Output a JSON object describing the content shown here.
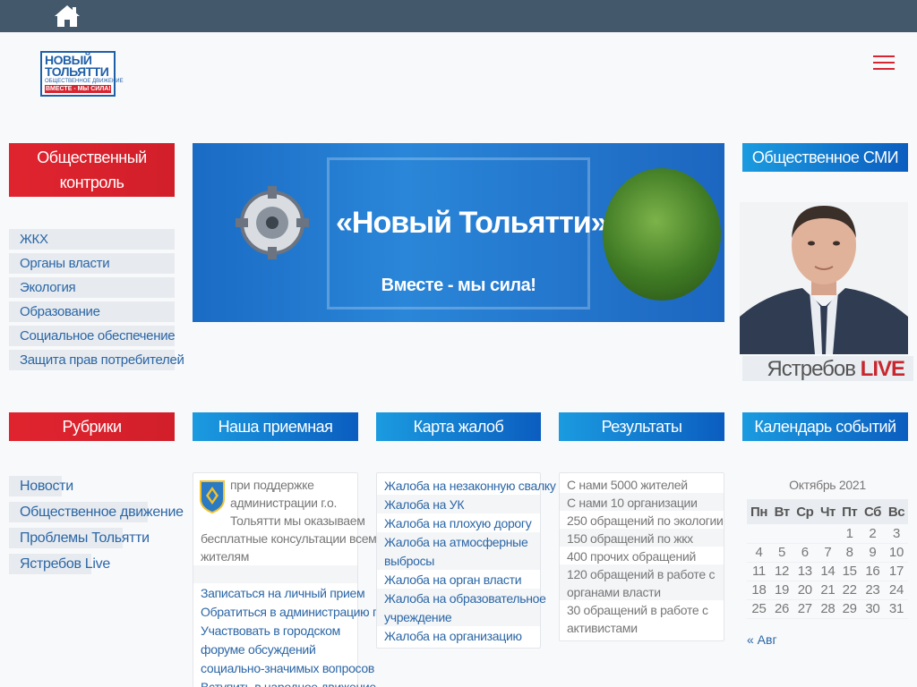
{
  "header": {
    "logo": {
      "line1": "НОВЫЙ",
      "line2": "ТОЛЬЯТТИ",
      "line3": "ОБЩЕСТВЕННОЕ ДВИЖЕНИЕ",
      "line4": "ВМЕСТЕ - МЫ СИЛА!"
    }
  },
  "public_control": {
    "title": "Общественный контроль",
    "items": [
      "ЖКХ",
      "Органы власти",
      "Экология",
      "Образование",
      "Социальное обеспечение",
      "Защита прав потребителей"
    ]
  },
  "banner": {
    "title": "«Новый Тольятти»",
    "slogan": "Вместе - мы сила!"
  },
  "media": {
    "title": "Общественное СМИ",
    "name": "Ястребов",
    "live": "LIVE"
  },
  "rubrics": {
    "title": "Рубрики",
    "items": [
      "Новости",
      "Общественное движение",
      "Проблемы Тольятти",
      "Ястребов Live"
    ]
  },
  "reception": {
    "title": "Наша приемная",
    "text_lines": [
      "при поддержке",
      "администрации г.о.",
      "Тольятти мы оказываем",
      "бесплатные консультации всем",
      "жителям"
    ],
    "links": [
      "Записаться на личный прием",
      "Обратиться в администрацию города",
      "Участвовать в городском",
      "форуме обсуждений",
      "социально-значимых вопросов",
      "Вступить в народное движение"
    ]
  },
  "complaints": {
    "title": "Карта жалоб",
    "items": [
      "Жалоба на незаконную свалку",
      "Жалоба на УК",
      "Жалоба на плохую дорогу",
      "Жалоба на атмосферные",
      "выбросы",
      "Жалоба на орган власти",
      "Жалоба на образовательное",
      "учреждение",
      "Жалоба на организацию"
    ]
  },
  "results": {
    "title": "Результаты",
    "items": [
      "С нами 5000 жителей",
      "С нами 10 организации",
      "250 обращений по экологии",
      "150 обращений по жкх",
      "400 прочих обращений",
      "120 обращений в работе с",
      "органами власти",
      "30 обращений в работе с",
      "активистами"
    ]
  },
  "calendar": {
    "title": "Календарь событий",
    "caption": "Октябрь 2021",
    "weekdays": [
      "Пн",
      "Вт",
      "Ср",
      "Чт",
      "Пт",
      "Сб",
      "Вс"
    ],
    "weeks": [
      [
        "",
        "",
        "",
        "",
        "1",
        "2",
        "3"
      ],
      [
        "4",
        "5",
        "6",
        "7",
        "8",
        "9",
        "10"
      ],
      [
        "11",
        "12",
        "13",
        "14",
        "15",
        "16",
        "17"
      ],
      [
        "18",
        "19",
        "20",
        "21",
        "22",
        "23",
        "24"
      ],
      [
        "25",
        "26",
        "27",
        "28",
        "29",
        "30",
        "31"
      ]
    ],
    "prev": "« Авг"
  },
  "colors": {
    "red": "#e0242f",
    "blue": "#1b84d6",
    "topbar": "#44586c",
    "link": "#2b66a6"
  },
  "icons": {
    "home": "home-icon",
    "menu": "hamburger-menu-icon"
  }
}
